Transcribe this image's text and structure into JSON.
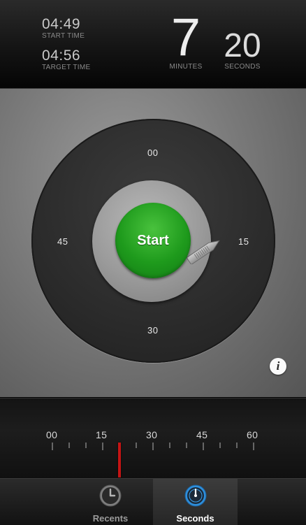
{
  "header": {
    "start_time": "04:49",
    "start_label": "START TIME",
    "target_time": "04:56",
    "target_label": "TARGET TIME",
    "minutes_value": "7",
    "minutes_label": "MINUTES",
    "seconds_value": "20",
    "seconds_label": "SECONDS"
  },
  "dial": {
    "top_label": "00",
    "right_label": "15",
    "bottom_label": "30",
    "left_label": "45",
    "start_label": "Start",
    "info_glyph": "i"
  },
  "ruler": {
    "labels": [
      "00",
      "15",
      "30",
      "45",
      "60"
    ],
    "indicator_seconds": 20
  },
  "tabs": [
    {
      "label": "Recents",
      "icon": "clock-icon",
      "active": false
    },
    {
      "label": "Seconds",
      "icon": "stopwatch-icon",
      "active": true
    }
  ],
  "colors": {
    "start_green": "#1e9a1c",
    "indicator_red": "#c41414",
    "active_tab_blue": "#2e8fdc"
  }
}
